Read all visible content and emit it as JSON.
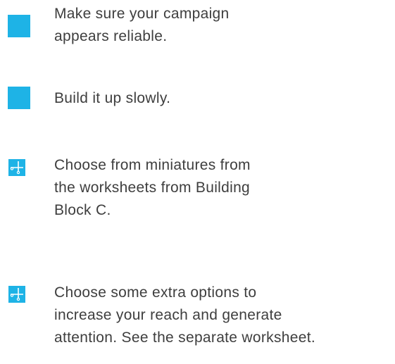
{
  "items": [
    {
      "marker": "blue-square",
      "lines": [
        "Make sure your campaign",
        "appears reliable."
      ]
    },
    {
      "marker": "blue-square",
      "lines": [
        "Build it up slowly."
      ]
    },
    {
      "marker": "scissors-icon",
      "lines": [
        "Choose from miniatures from",
        "the worksheets from Building",
        "Block C."
      ]
    },
    {
      "marker": "scissors-icon",
      "lines": [
        "Choose some extra options to",
        "increase your reach and generate",
        "attention. See the separate worksheet."
      ]
    }
  ],
  "colors": {
    "accent": "#1eb3e6",
    "text": "#3e3e3e"
  }
}
